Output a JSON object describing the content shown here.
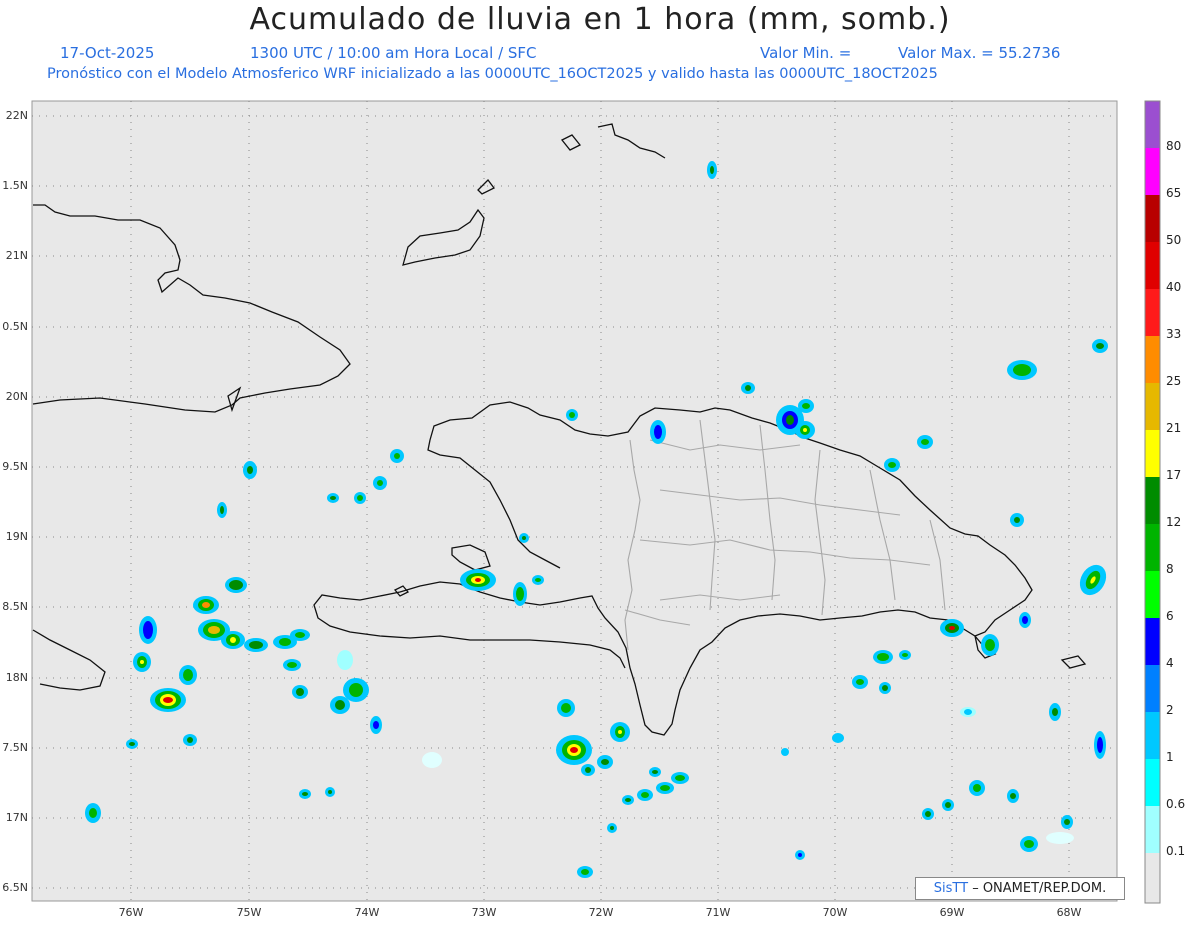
{
  "title": "Acumulado de lluvia en 1 hora (mm, somb.)",
  "subtitle_line1": {
    "date": "17-Oct-2025",
    "time": "1300 UTC / 10:00 am Hora Local / SFC",
    "min": "Valor Min. =",
    "max": "Valor Max. = 55.2736"
  },
  "subtitle_line2": "Pronóstico con el Modelo Atmosferico WRF inicializado a las 0000UTC_16OCT2025 y valido hasta las  0000UTC_18OCT2025",
  "lat_labels": [
    "22N",
    "1.5N",
    "21N",
    "0.5N",
    "20N",
    "9.5N",
    "19N",
    "8.5N",
    "18N",
    "7.5N",
    "17N",
    "6.5N"
  ],
  "lon_labels": [
    "76W",
    "75W",
    "74W",
    "73W",
    "72W",
    "71W",
    "70W",
    "69W",
    "68W"
  ],
  "colorbar": {
    "labels": [
      "80",
      "65",
      "50",
      "40",
      "33",
      "25",
      "21",
      "17",
      "12",
      "8",
      "6",
      "4",
      "2",
      "1",
      "0.6",
      "0.1"
    ],
    "colors": [
      "#9b4fd0",
      "#ff00ff",
      "#b80000",
      "#e00000",
      "#ff1a1a",
      "#ff8c00",
      "#e6b800",
      "#ffff00",
      "#008c00",
      "#00b400",
      "#00ff00",
      "#0000ff",
      "#0080ff",
      "#00c8ff",
      "#00ffff",
      "#a0ffff",
      "#e0ffff",
      "#e8e8e8"
    ]
  },
  "credit": {
    "logo": "SisTT",
    "text": " – ONAMET/REP.DOM."
  },
  "icons": {
    "map": "rainfall-map"
  }
}
